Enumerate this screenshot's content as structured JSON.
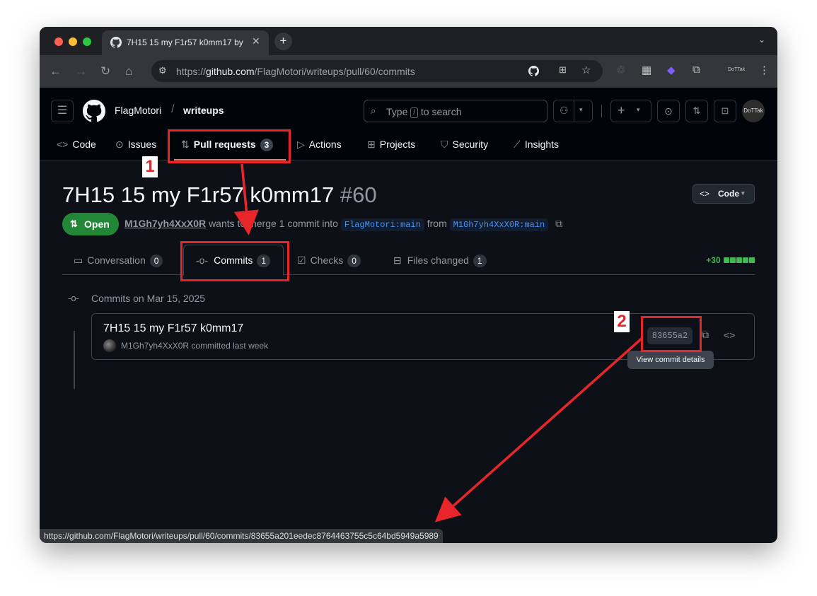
{
  "browser": {
    "tab_title": "7H15 15 my F1r57 k0mm17 by",
    "address_prefix": "https://",
    "address_host": "github.com",
    "address_path": "/FlagMotori/writeups/pull/60/commits",
    "extension_label": "DoTTak",
    "status_url": "https://github.com/FlagMotori/writeups/pull/60/commits/83655a201eedec8764463755c5c64bd5949a5989"
  },
  "repo": {
    "owner": "FlagMotori",
    "separator": "/",
    "name": "writeups",
    "search_prefix": "Type",
    "search_key": "/",
    "search_suffix": "to search",
    "avatar_label": "DoTTak"
  },
  "repo_nav": [
    {
      "label": "Code",
      "icon": "code-icon"
    },
    {
      "label": "Issues",
      "icon": "issue-icon"
    },
    {
      "label": "Pull requests",
      "icon": "pull-request-icon",
      "count": "3"
    },
    {
      "label": "Actions",
      "icon": "play-icon"
    },
    {
      "label": "Projects",
      "icon": "table-icon"
    },
    {
      "label": "Security",
      "icon": "shield-icon"
    },
    {
      "label": "Insights",
      "icon": "graph-icon"
    }
  ],
  "pr": {
    "title": "7H15 15 my F1r57 k0mm17",
    "number": "#60",
    "code_button": "Code",
    "state": "Open",
    "author": "M1Gh7yh4XxX0R",
    "meta_text": "wants to merge 1 commit into",
    "base_branch": "FlagMotori:main",
    "from_text": "from",
    "head_branch": "M1Gh7yh4XxX0R:main",
    "diffstat": "+30"
  },
  "pr_tabs": [
    {
      "label": "Conversation",
      "count": "0",
      "icon": "comment-icon"
    },
    {
      "label": "Commits",
      "count": "1",
      "icon": "commit-icon"
    },
    {
      "label": "Checks",
      "count": "0",
      "icon": "checklist-icon"
    },
    {
      "label": "Files changed",
      "count": "1",
      "icon": "file-diff-icon"
    }
  ],
  "commits": {
    "group_label": "Commits on Mar 15, 2025",
    "items": [
      {
        "title": "7H15 15 my F1r57 k0mm17",
        "author": "M1Gh7yh4XxX0R",
        "meta": "committed last week",
        "sha": "83655a2",
        "tooltip": "View commit details"
      }
    ]
  },
  "annotations": {
    "marker1": "1",
    "marker2": "2",
    "color": "#e8262a"
  }
}
